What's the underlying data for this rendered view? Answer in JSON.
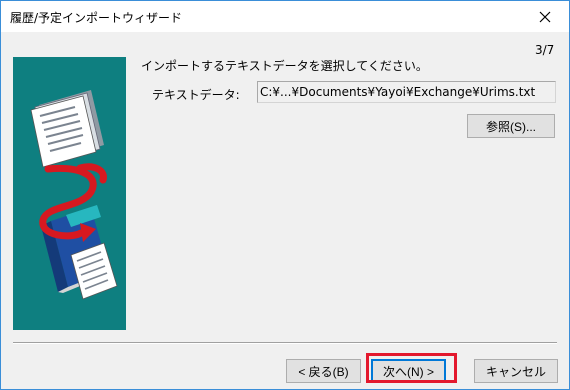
{
  "window": {
    "title": "履歴/予定インポートウィザード",
    "close_icon": "close-icon"
  },
  "wizard": {
    "step": "3/7",
    "instruction": "インポートするテキストデータを選択してください。",
    "text_data_label": "テキストデータ:",
    "text_data_value": "C:¥...¥Documents¥Yayoi¥Exchange¥Urims.txt",
    "browse_label": "参照(S)...",
    "illustration_icon": "import-documents-illustration"
  },
  "footer": {
    "back_label": "< 戻る(B)",
    "next_label": "次へ(N) >",
    "cancel_label": "キャンセル"
  },
  "colors": {
    "illustration_background": "#0e7f80",
    "highlight_box": "#e3182d",
    "default_button_border": "#0078d7"
  }
}
